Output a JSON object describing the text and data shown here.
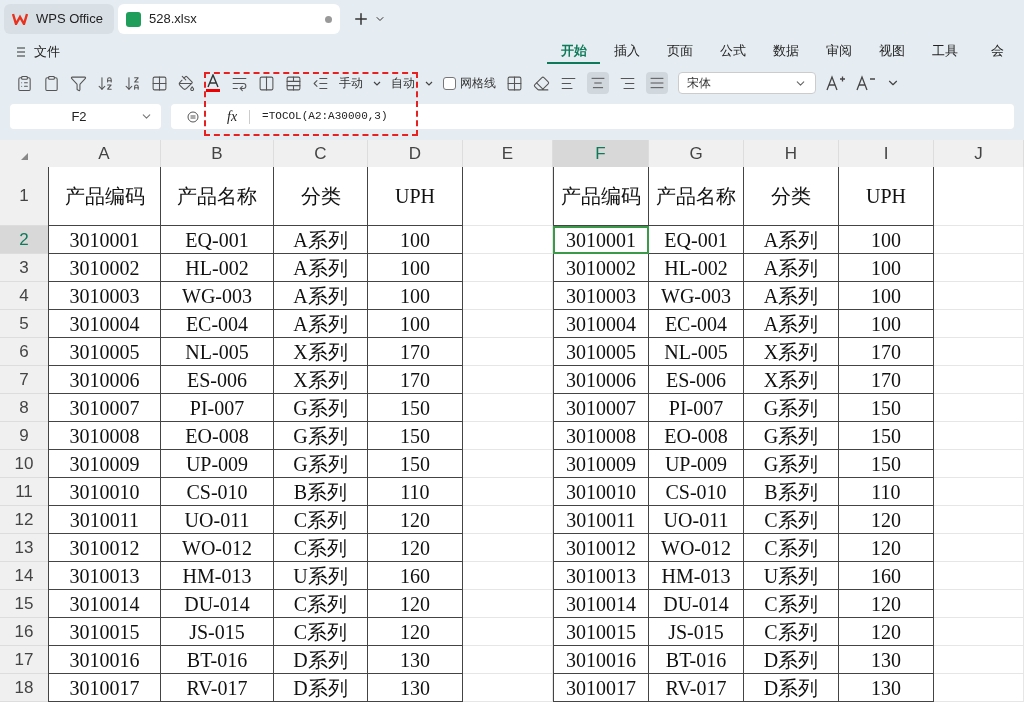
{
  "app_tabs": [
    {
      "label": "WPS Office",
      "kind": "home",
      "selected": false
    },
    {
      "label": "528.xlsx",
      "kind": "sheet",
      "selected": true
    }
  ],
  "menu": {
    "file": "文件",
    "ribbon_tabs": [
      {
        "label": "开始",
        "selected": true
      },
      {
        "label": "插入",
        "selected": false
      },
      {
        "label": "页面",
        "selected": false
      },
      {
        "label": "公式",
        "selected": false
      },
      {
        "label": "数据",
        "selected": false
      },
      {
        "label": "审阅",
        "selected": false
      },
      {
        "label": "视图",
        "selected": false
      },
      {
        "label": "工具",
        "selected": false
      },
      {
        "label": "会",
        "selected": false
      }
    ]
  },
  "toolbar": {
    "row_height_mode": "手动",
    "col_width_mode": "自动",
    "gridlines": {
      "label": "网格线",
      "checked": false
    },
    "font": "宋体",
    "align_center_selected": true
  },
  "formula_bar": {
    "cell_ref": "F2",
    "fx": "fx",
    "formula": "=TOCOL(A2:A30000,3)"
  },
  "columns": [
    {
      "label": "A",
      "selected": false
    },
    {
      "label": "B",
      "selected": false
    },
    {
      "label": "C",
      "selected": false
    },
    {
      "label": "D",
      "selected": false
    },
    {
      "label": "E",
      "selected": false
    },
    {
      "label": "F",
      "selected": true
    },
    {
      "label": "G",
      "selected": false
    },
    {
      "label": "H",
      "selected": false
    },
    {
      "label": "I",
      "selected": false
    },
    {
      "label": "J",
      "selected": false
    }
  ],
  "row_numbers": [
    {
      "label": "1",
      "selected": false
    },
    {
      "label": "2",
      "selected": true
    },
    {
      "label": "3",
      "selected": false
    },
    {
      "label": "4",
      "selected": false
    },
    {
      "label": "5",
      "selected": false
    },
    {
      "label": "6",
      "selected": false
    },
    {
      "label": "7",
      "selected": false
    },
    {
      "label": "8",
      "selected": false
    },
    {
      "label": "9",
      "selected": false
    },
    {
      "label": "10",
      "selected": false
    },
    {
      "label": "11",
      "selected": false
    },
    {
      "label": "12",
      "selected": false
    },
    {
      "label": "13",
      "selected": false
    },
    {
      "label": "14",
      "selected": false
    },
    {
      "label": "15",
      "selected": false
    },
    {
      "label": "16",
      "selected": false
    },
    {
      "label": "17",
      "selected": false
    },
    {
      "label": "18",
      "selected": false
    }
  ],
  "source_table": {
    "headers": [
      "产品编码",
      "产品名称",
      "分类",
      "UPH"
    ],
    "rows": [
      [
        "3010001",
        "EQ-001",
        "A系列",
        "100"
      ],
      [
        "3010002",
        "HL-002",
        "A系列",
        "100"
      ],
      [
        "3010003",
        "WG-003",
        "A系列",
        "100"
      ],
      [
        "3010004",
        "EC-004",
        "A系列",
        "100"
      ],
      [
        "3010005",
        "NL-005",
        "X系列",
        "170"
      ],
      [
        "3010006",
        "ES-006",
        "X系列",
        "170"
      ],
      [
        "3010007",
        "PI-007",
        "G系列",
        "150"
      ],
      [
        "3010008",
        "EO-008",
        "G系列",
        "150"
      ],
      [
        "3010009",
        "UP-009",
        "G系列",
        "150"
      ],
      [
        "3010010",
        "CS-010",
        "B系列",
        "110"
      ],
      [
        "3010011",
        "UO-011",
        "C系列",
        "120"
      ],
      [
        "3010012",
        "WO-012",
        "C系列",
        "120"
      ],
      [
        "3010013",
        "HM-013",
        "U系列",
        "160"
      ],
      [
        "3010014",
        "DU-014",
        "C系列",
        "120"
      ],
      [
        "3010015",
        "JS-015",
        "C系列",
        "120"
      ],
      [
        "3010016",
        "BT-016",
        "D系列",
        "130"
      ],
      [
        "3010017",
        "RV-017",
        "D系列",
        "130"
      ]
    ]
  },
  "result_table": {
    "headers": [
      "产品编码",
      "产品名称",
      "分类",
      "UPH"
    ],
    "rows": [
      [
        "3010001",
        "EQ-001",
        "A系列",
        "100"
      ],
      [
        "3010002",
        "HL-002",
        "A系列",
        "100"
      ],
      [
        "3010003",
        "WG-003",
        "A系列",
        "100"
      ],
      [
        "3010004",
        "EC-004",
        "A系列",
        "100"
      ],
      [
        "3010005",
        "NL-005",
        "X系列",
        "170"
      ],
      [
        "3010006",
        "ES-006",
        "X系列",
        "170"
      ],
      [
        "3010007",
        "PI-007",
        "G系列",
        "150"
      ],
      [
        "3010008",
        "EO-008",
        "G系列",
        "150"
      ],
      [
        "3010009",
        "UP-009",
        "G系列",
        "150"
      ],
      [
        "3010010",
        "CS-010",
        "B系列",
        "110"
      ],
      [
        "3010011",
        "UO-011",
        "C系列",
        "120"
      ],
      [
        "3010012",
        "WO-012",
        "C系列",
        "120"
      ],
      [
        "3010013",
        "HM-013",
        "U系列",
        "160"
      ],
      [
        "3010014",
        "DU-014",
        "C系列",
        "120"
      ],
      [
        "3010015",
        "JS-015",
        "C系列",
        "120"
      ],
      [
        "3010016",
        "BT-016",
        "D系列",
        "130"
      ],
      [
        "3010017",
        "RV-017",
        "D系列",
        "130"
      ]
    ]
  }
}
